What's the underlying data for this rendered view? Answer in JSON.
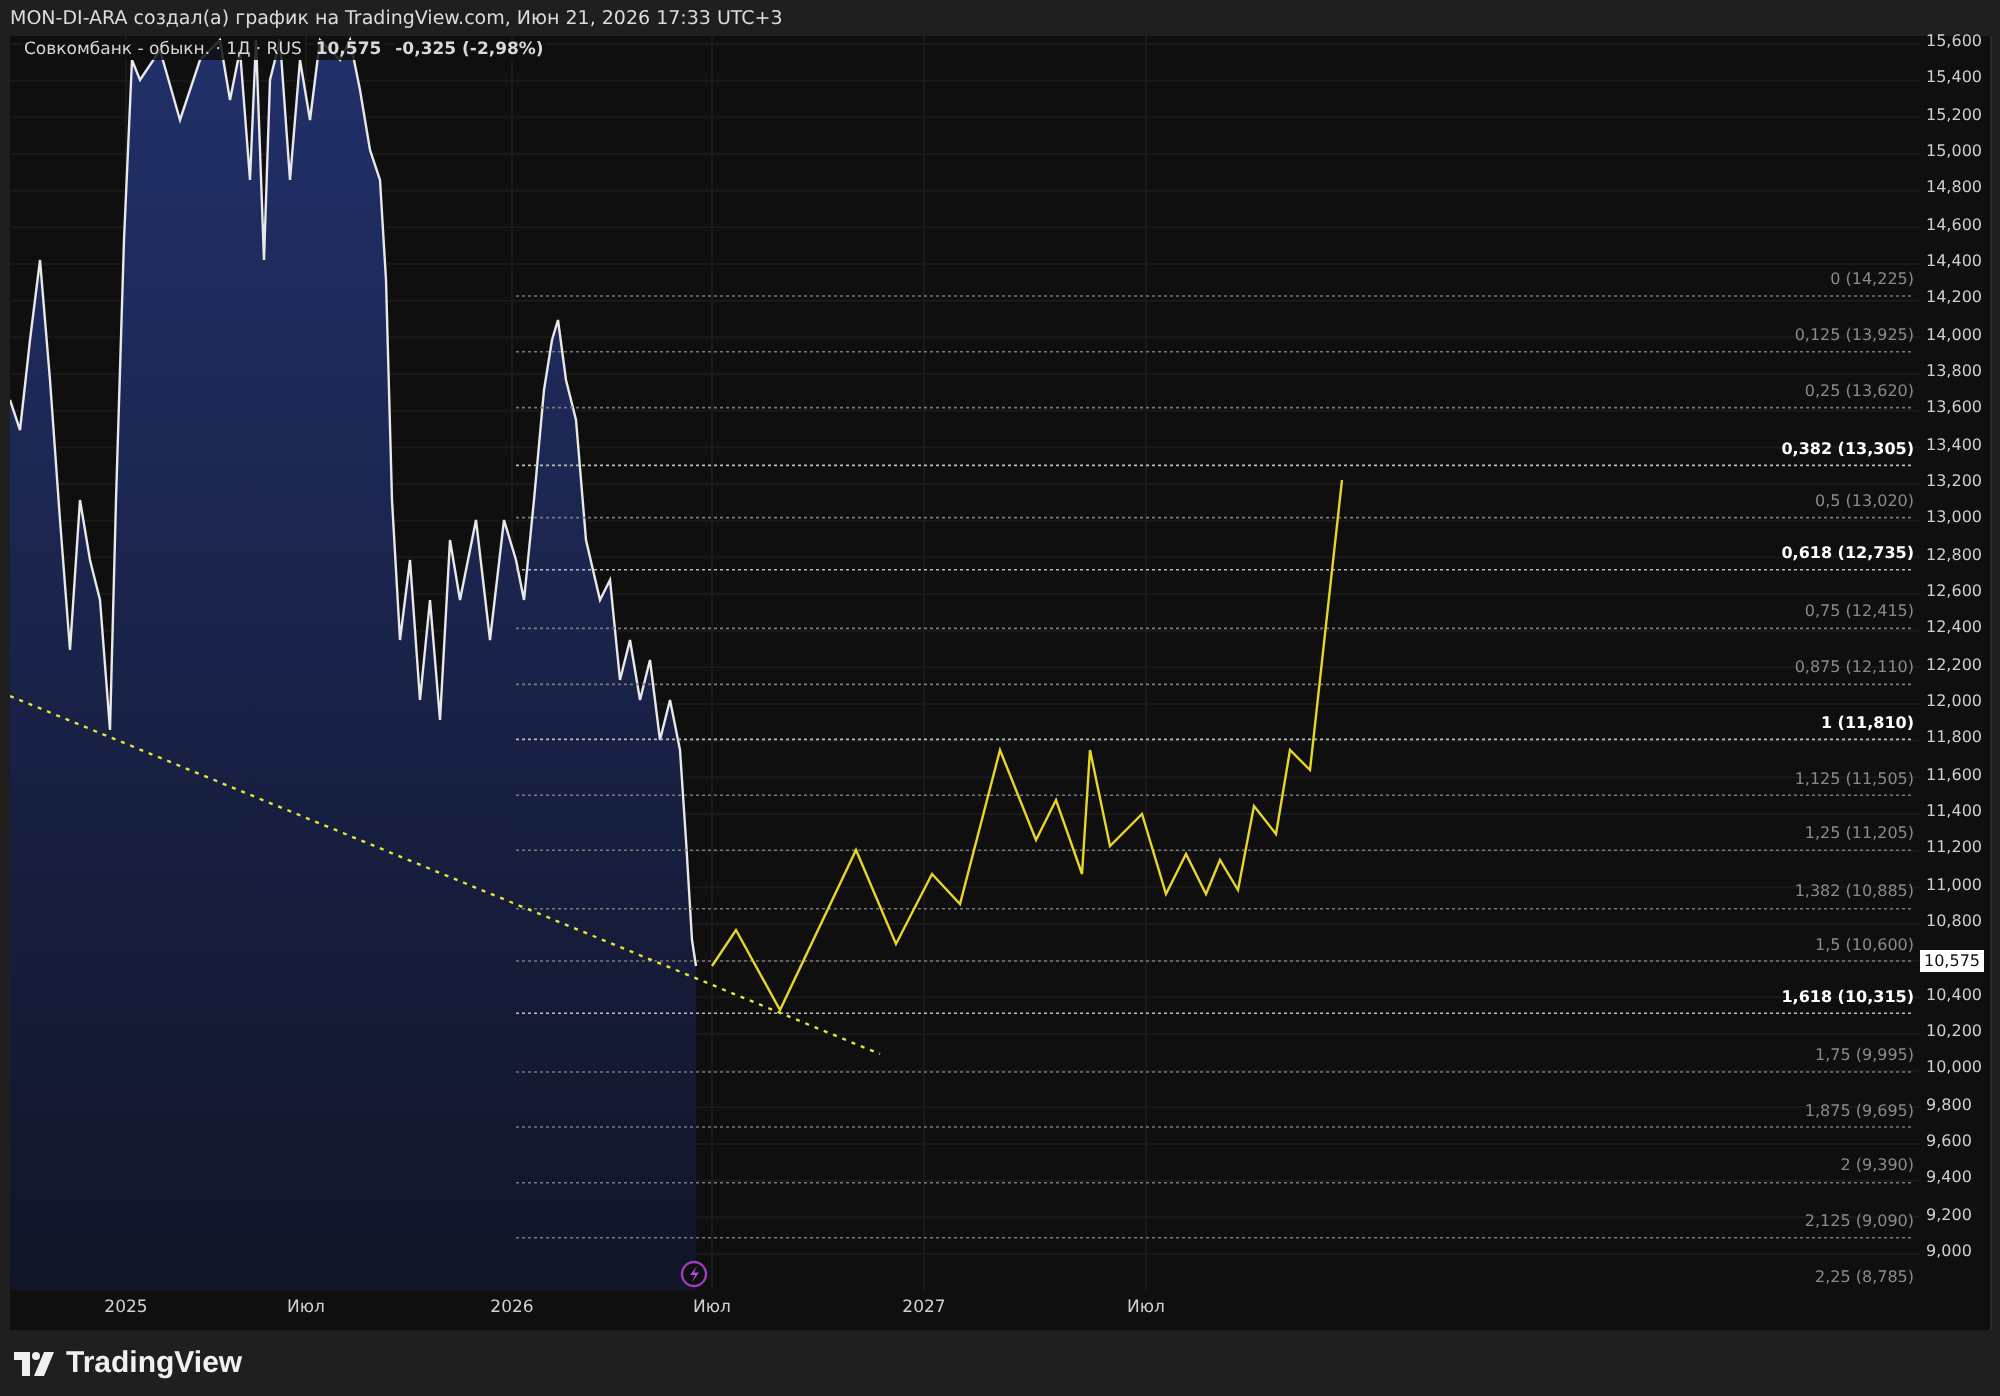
{
  "header": {
    "text": "MON-DI-ARA создал(а) график на TradingView.com, Июн 21, 2026 17:33 UTC+3"
  },
  "legend": {
    "symbol": "Совкомбанк - обыкн. · 1Д · RUS",
    "price": "10,575",
    "change": "-0,325 (-2,98%)"
  },
  "price_axis": {
    "labels": [
      "15,600",
      "15,400",
      "15,200",
      "15,000",
      "14,800",
      "14,600",
      "14,400",
      "14,200",
      "14,000",
      "13,800",
      "13,600",
      "13,400",
      "13,200",
      "13,000",
      "12,800",
      "12,600",
      "12,400",
      "12,200",
      "12,000",
      "11,800",
      "11,600",
      "11,400",
      "11,200",
      "11,000",
      "10,800",
      "10,400",
      "10,200",
      "10,000",
      "9,800",
      "9,600",
      "9,400",
      "9,200",
      "9,000"
    ],
    "last_price": "10,575"
  },
  "fib_levels": [
    {
      "label": "0 (14,225)",
      "emphasized": false
    },
    {
      "label": "0,125 (13,925)",
      "emphasized": false
    },
    {
      "label": "0,25 (13,620)",
      "emphasized": false
    },
    {
      "label": "0,382 (13,305)",
      "emphasized": true
    },
    {
      "label": "0,5 (13,020)",
      "emphasized": false
    },
    {
      "label": "0,618 (12,735)",
      "emphasized": true
    },
    {
      "label": "0,75 (12,415)",
      "emphasized": false
    },
    {
      "label": "0,875 (12,110)",
      "emphasized": false
    },
    {
      "label": "1 (11,810)",
      "emphasized": true
    },
    {
      "label": "1,125 (11,505)",
      "emphasized": false
    },
    {
      "label": "1,25 (11,205)",
      "emphasized": false
    },
    {
      "label": "1,382 (10,885)",
      "emphasized": false
    },
    {
      "label": "1,5 (10,600)",
      "emphasized": false
    },
    {
      "label": "1,618 (10,315)",
      "emphasized": true
    },
    {
      "label": "1,75 (9,995)",
      "emphasized": false
    },
    {
      "label": "1,875 (9,695)",
      "emphasized": false
    },
    {
      "label": "2 (9,390)",
      "emphasized": false
    },
    {
      "label": "2,125 (9,090)",
      "emphasized": false
    },
    {
      "label": "2,25 (8,785)",
      "emphasized": false
    }
  ],
  "time_axis": {
    "labels": [
      "2025",
      "Июл",
      "2026",
      "Июл",
      "2027",
      "Июл"
    ]
  },
  "footer": {
    "brand": "TradingView"
  }
}
